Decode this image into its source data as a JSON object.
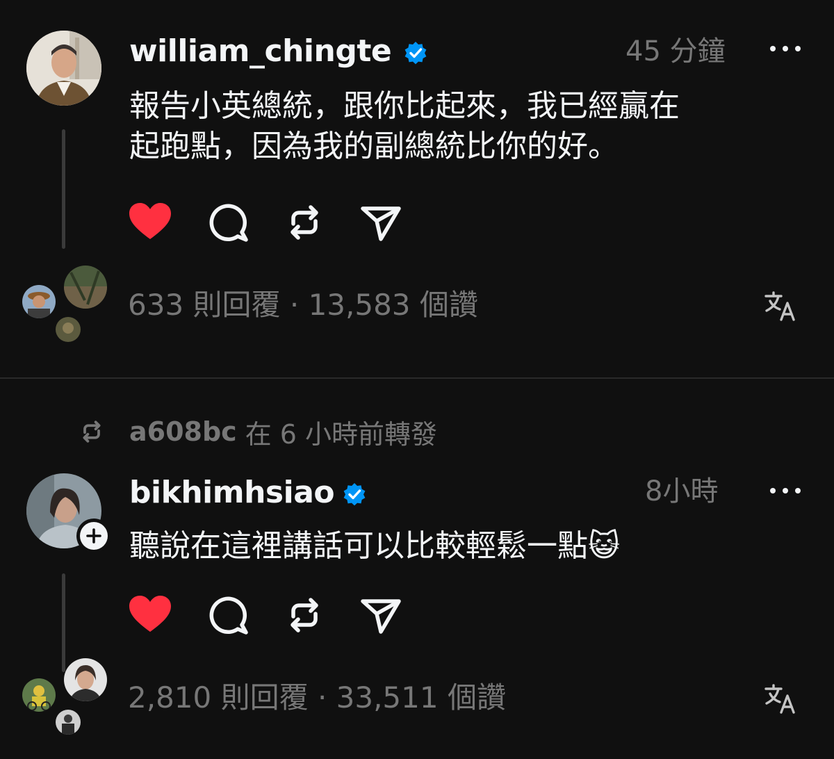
{
  "colors": {
    "background": "#101010",
    "text_primary": "#f3f5f7",
    "text_secondary": "#777777",
    "heart": "#ff3040",
    "verified": "#0095f6",
    "thread_line": "#3a3a3a"
  },
  "posts": [
    {
      "username": "william_chingte",
      "verified": true,
      "time": "45 分鐘",
      "text": "報告小英總統，跟你比起來，我已經贏在\n起跑點，因為我的副總統比你的好。",
      "liked": true,
      "stats": "633 則回覆 · 13,583 個讚",
      "icons": [
        "heart-icon",
        "comment-icon",
        "repost-icon",
        "share-icon",
        "translate-icon",
        "more-icon"
      ]
    },
    {
      "repost_user": "a608bc",
      "repost_text": "在 6 小時前轉發",
      "username": "bikhimhsiao",
      "verified": true,
      "time": "8小時",
      "text": "聽說在這裡講話可以比較輕鬆一點😺",
      "liked": true,
      "stats": "2,810 則回覆 · 33,511 個讚",
      "icons": [
        "heart-icon",
        "comment-icon",
        "repost-icon",
        "share-icon",
        "translate-icon",
        "more-icon",
        "follow-plus-icon"
      ]
    }
  ]
}
